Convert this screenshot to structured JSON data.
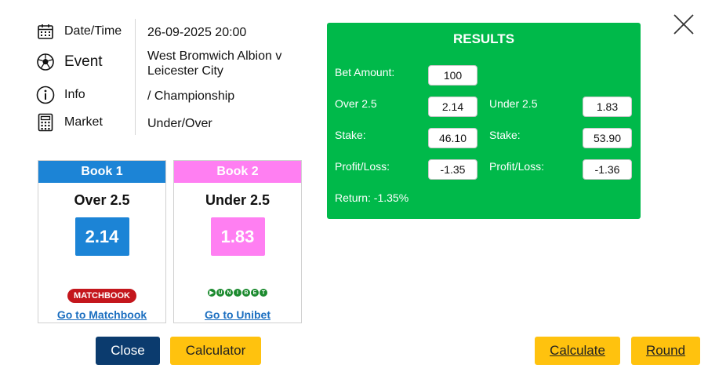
{
  "info": {
    "datetime_label": "Date/Time",
    "datetime_value": "26-09-2025 20:00",
    "event_label": "Event",
    "event_value_line1": "West Bromwich Albion v",
    "event_value_line2": "Leicester City",
    "info_label": "Info",
    "info_value": "/ Championship",
    "market_label": "Market",
    "market_value": "Under/Over"
  },
  "books": [
    {
      "header": "Book 1",
      "market": "Over 2.5",
      "odds": "2.14",
      "logo_text": "MATCHBOOK",
      "link": "Go to Matchbook",
      "color": "#1c84d6"
    },
    {
      "header": "Book 2",
      "market": "Under 2.5",
      "odds": "1.83",
      "logo_text": "UNIBET",
      "link": "Go to Unibet",
      "color": "#ff7ff2"
    }
  ],
  "results": {
    "title": "RESULTS",
    "bet_amount_label": "Bet Amount:",
    "bet_amount": "100",
    "over_label": "Over 2.5",
    "over_odds": "2.14",
    "under_label": "Under 2.5",
    "under_odds": "1.83",
    "stake_label": "Stake:",
    "stake_over": "46.10",
    "stake_under": "53.90",
    "pl_label": "Profit/Loss:",
    "pl_over": "-1.35",
    "pl_under": "-1.36",
    "return_text": "Return: -1.35%",
    "color": "#00b94a"
  },
  "buttons": {
    "close": "Close",
    "calculator": "Calculator",
    "calculate": "Calculate",
    "round": "Round"
  }
}
